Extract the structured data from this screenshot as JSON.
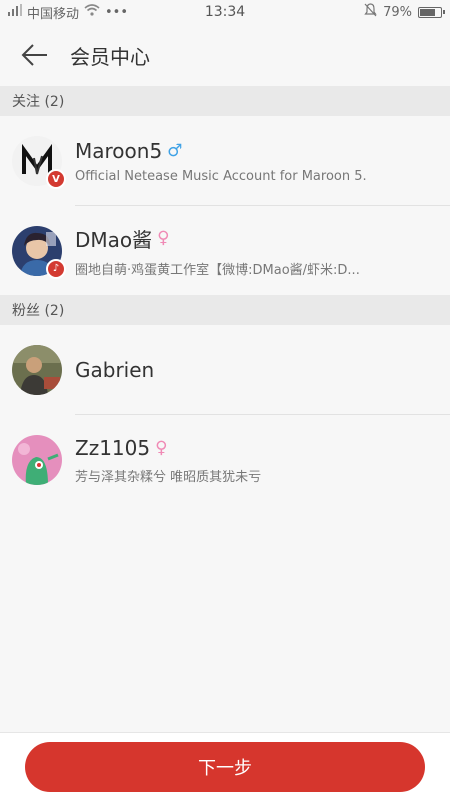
{
  "status_bar": {
    "carrier": "中国移动",
    "dots": "•••",
    "time": "13:34",
    "battery": "79%",
    "battery_level": 0.79
  },
  "header": {
    "title": "会员中心"
  },
  "sections": [
    {
      "title": "关注 (2)",
      "users": [
        {
          "name": "Maroon5",
          "gender_symbol": "♂",
          "desc": "Official Netease Music Account for Maroon 5.",
          "badge": "V"
        },
        {
          "name": "DMao酱",
          "gender_symbol": "♀",
          "desc": "圈地自萌·鸡蛋黄工作室【微博:DMao酱/虾米:D...",
          "badge": "♪"
        }
      ]
    },
    {
      "title": "粉丝 (2)",
      "users": [
        {
          "name": "Gabrien"
        },
        {
          "name": "Zz1105",
          "gender_symbol": "♀",
          "desc": "芳与泽其杂糅兮 唯昭质其犹未亏"
        }
      ]
    }
  ],
  "footer": {
    "next_label": "下一步"
  },
  "colors": {
    "accent": "#d6362d",
    "male": "#3fa2e6",
    "female": "#f08ab5"
  }
}
